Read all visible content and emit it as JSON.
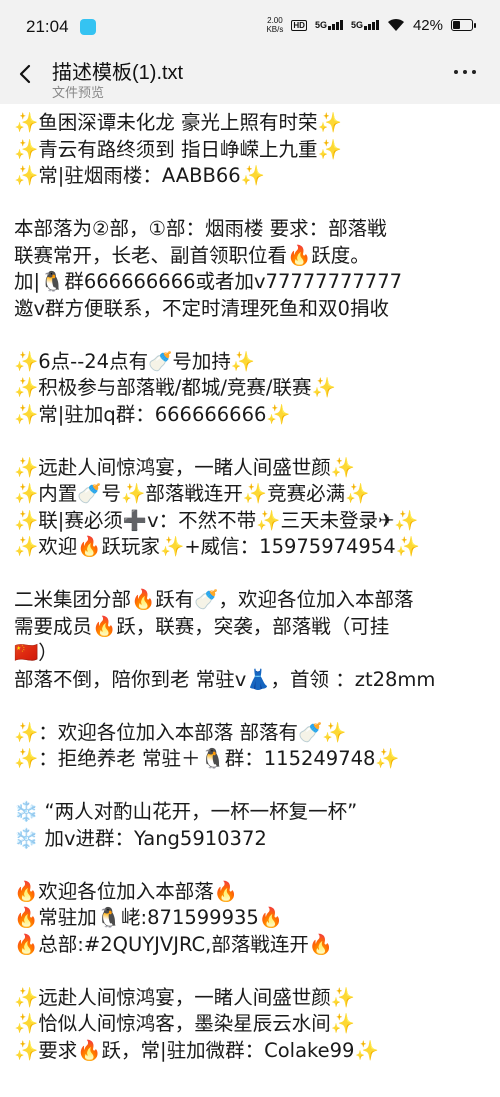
{
  "status_bar": {
    "time": "21:04",
    "net_speed_value": "2.00",
    "net_speed_unit": "KB/s",
    "hd_label": "HD",
    "sim1": "5G",
    "sim2": "5G",
    "battery": "42%",
    "battery_level": 0.42
  },
  "header": {
    "title": "描述模板(1).txt",
    "subtitle": "文件预览"
  },
  "document": {
    "lines": [
      "✨鱼困深谭未化龙 豪光上照有时荣✨",
      "✨青云有路终须到 指日峥嵘上九重✨",
      "✨常|驻烟雨楼：AABB66✨",
      "",
      "本部落为②部，①部：烟雨楼 要求：部落戦",
      "联赛常开，长老、副首领职位看🔥跃度。",
      "加|🐧群666666666或者加v77777777777",
      "邀v群方便联系，不定时清理死鱼和双0捐收",
      "",
      "✨6点--24点有🍼号加持✨",
      "✨积极参与部落戦/都城/竞赛/联赛✨",
      "✨常|驻加q群：666666666✨",
      "",
      "✨远赴人间惊鸿宴，一睹人间盛世颜✨",
      "✨内置🍼号✨部落戦连开✨竞赛必满✨",
      "✨联|赛必须➕v：不然不带✨三天未登录✈✨",
      "✨欢迎🔥跃玩家✨+威信：15975974954✨",
      "",
      "二米集团分部🔥跃有🍼，欢迎各位加入本部落",
      "需要成员🔥跃，联赛，突袭，部落戦（可挂",
      "🇨🇳）",
      "部落不倒，陪你到老 常驻v👗，首领 ：zt28mm",
      "",
      "✨：欢迎各位加入本部落 部落有🍼✨",
      "✨：拒绝养老 常驻＋🐧群：115249748✨",
      "",
      "❄️ “两人对酌山花开，一杯一杯复一杯”",
      "❄️ 加v进群：Yang5910372",
      "",
      "🔥欢迎各位加入本部落🔥",
      "🔥常驻加🐧峔:871599935🔥",
      "🔥总部:#2QUYJVJRC,部落戦连开🔥",
      "",
      "✨远赴人间惊鸿宴，一睹人间盛世颜✨",
      "✨恰似人间惊鸿客，墨染星辰云水间✨",
      "✨要求🔥跃，常|驻加微群：Colake99✨"
    ]
  }
}
